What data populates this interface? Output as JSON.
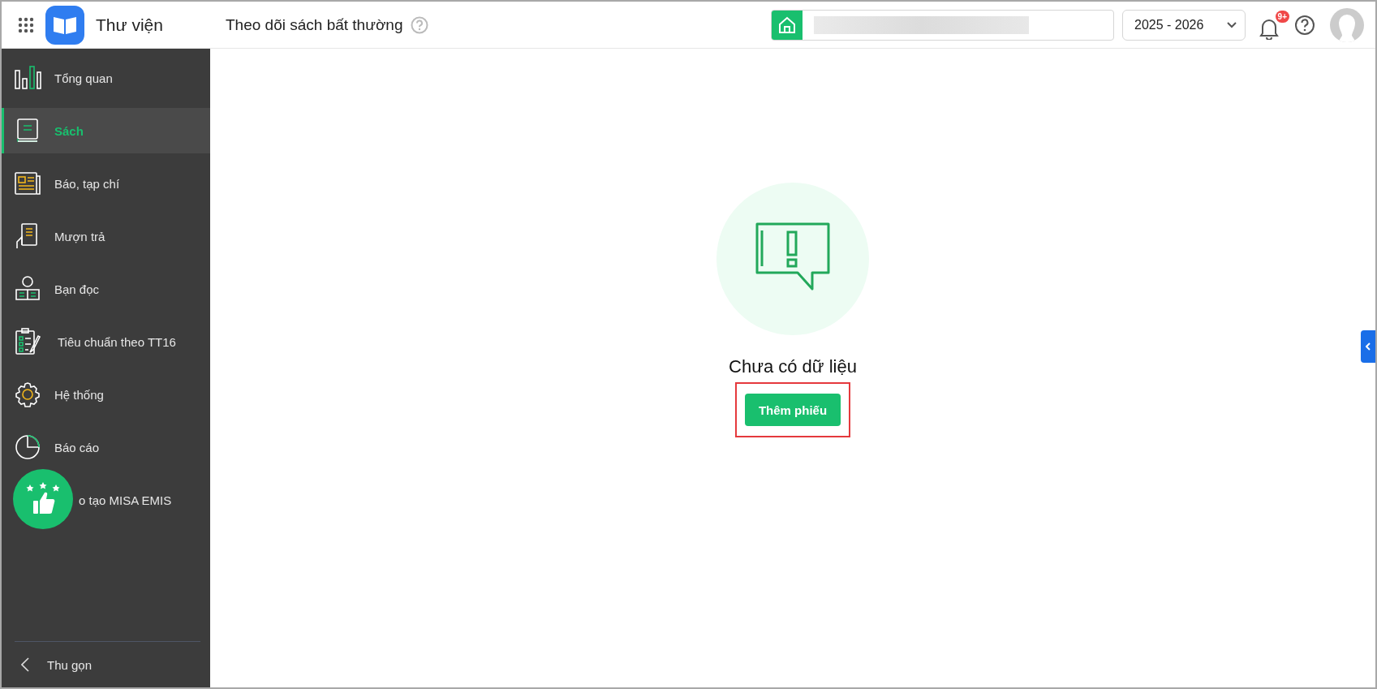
{
  "app": {
    "name": "Thư viện"
  },
  "page": {
    "title": "Theo dõi sách bất thường"
  },
  "header": {
    "school_year": "2025 - 2026",
    "notification_badge": "9+"
  },
  "sidebar": {
    "items": [
      {
        "kind": "overview",
        "label": "Tổng quan",
        "selected": false
      },
      {
        "kind": "book",
        "label": "Sách",
        "selected": true
      },
      {
        "kind": "newspaper",
        "label": "Báo, tạp chí",
        "selected": false
      },
      {
        "kind": "borrow",
        "label": "Mượn trả",
        "selected": false
      },
      {
        "kind": "reader",
        "label": "Bạn đọc",
        "selected": false
      },
      {
        "kind": "checklist",
        "label": "Tiêu chuẩn theo TT16",
        "selected": false
      },
      {
        "kind": "settings",
        "label": "Hệ thống",
        "selected": false
      },
      {
        "kind": "report",
        "label": "Báo cáo",
        "selected": false
      },
      {
        "kind": "training",
        "label": "o tạo MISA EMIS",
        "selected": false
      }
    ],
    "collapse": "Thu gọn"
  },
  "empty_state": {
    "message": "Chưa có dữ liệu",
    "button": "Thêm phiếu"
  }
}
